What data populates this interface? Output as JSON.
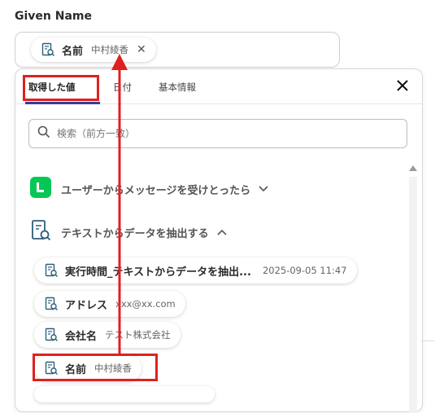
{
  "field": {
    "label": "Given Name"
  },
  "selected_chip": {
    "label": "名前",
    "value": "中村綾香"
  },
  "tabs": [
    {
      "label": "取得した値"
    },
    {
      "label": "日付"
    },
    {
      "label": "基本情報"
    }
  ],
  "search": {
    "placeholder": "検索（前方一致）"
  },
  "sections": [
    {
      "title": "ユーザーからメッセージを受けとったら",
      "expanded": false
    },
    {
      "title": "テキストからデータを抽出する",
      "expanded": true
    }
  ],
  "items": [
    {
      "label": "実行時間_テキストからデータを抽出...",
      "value": "2025-09-05 11:47"
    },
    {
      "label": "アドレス",
      "value": "xxx@xx.com"
    },
    {
      "label": "会社名",
      "value": "テスト株式会社"
    },
    {
      "label": "名前",
      "value": "中村綾香"
    }
  ],
  "colors": {
    "highlight": "#e02020",
    "line_green": "#06c755",
    "tab_underline": "#3a3a9a"
  }
}
